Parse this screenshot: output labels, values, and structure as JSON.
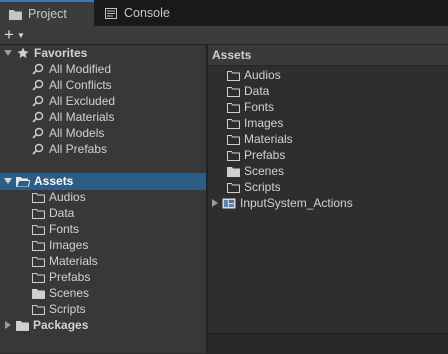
{
  "tabs": {
    "project": "Project",
    "console": "Console"
  },
  "toolbar": {
    "add_symbol": "+"
  },
  "favorites": {
    "title": "Favorites",
    "items": [
      "All Modified",
      "All Conflicts",
      "All Excluded",
      "All Materials",
      "All Models",
      "All Prefabs"
    ]
  },
  "tree": {
    "assets_label": "Assets",
    "folders": [
      "Audios",
      "Data",
      "Fonts",
      "Images",
      "Materials",
      "Prefabs",
      "Scenes",
      "Scripts"
    ],
    "packages_label": "Packages"
  },
  "right": {
    "header": "Assets",
    "folders": [
      "Audios",
      "Data",
      "Fonts",
      "Images",
      "Materials",
      "Prefabs",
      "Scenes",
      "Scripts"
    ],
    "asset_item": "InputSystem_Actions"
  },
  "colors": {
    "selection": "#2c5d87",
    "tab_accent": "#3a79bb"
  }
}
